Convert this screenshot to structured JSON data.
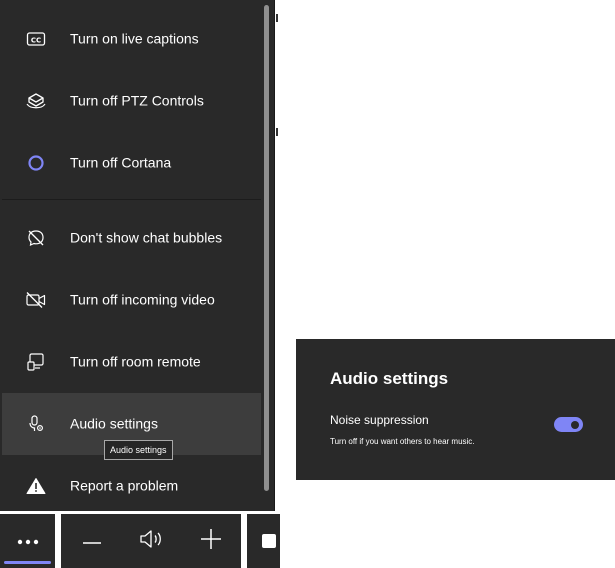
{
  "menu": {
    "items": [
      {
        "label": "Turn on live captions",
        "icon": "closed-captions-icon"
      },
      {
        "label": "Turn off PTZ Controls",
        "icon": "ptz-camera-icon"
      },
      {
        "label": "Turn off Cortana",
        "icon": "cortana-icon"
      },
      {
        "label": "Don't show chat bubbles",
        "icon": "chat-bubble-off-icon"
      },
      {
        "label": "Turn off incoming video",
        "icon": "video-off-icon"
      },
      {
        "label": "Turn off room remote",
        "icon": "room-remote-icon"
      },
      {
        "label": "Audio settings",
        "icon": "microphone-settings-icon",
        "selected": true
      },
      {
        "label": "Report a problem",
        "icon": "warning-icon"
      }
    ],
    "tooltip": "Audio settings"
  },
  "toolbar": {
    "more_icon": "more-icon",
    "volume_down_icon": "minus-icon",
    "volume_icon": "speaker-icon",
    "volume_up_icon": "plus-icon"
  },
  "audio_settings": {
    "title": "Audio settings",
    "noise_suppression": {
      "label": "Noise suppression",
      "help": "Turn off if you want others to hear music.",
      "enabled": true
    }
  },
  "colors": {
    "panel_bg": "#292929",
    "accent": "#7f85f5",
    "text": "#ffffff"
  }
}
